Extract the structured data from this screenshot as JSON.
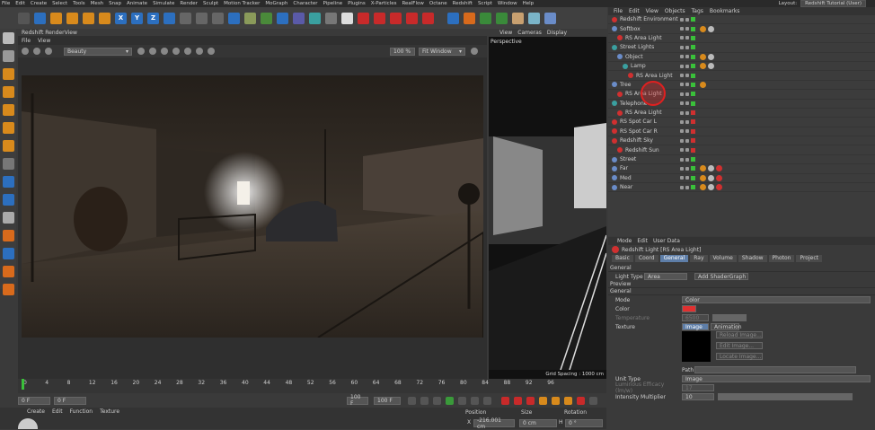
{
  "menubar": {
    "items": [
      "File",
      "Edit",
      "Create",
      "Select",
      "Tools",
      "Mesh",
      "Snap",
      "Animate",
      "Simulate",
      "Render",
      "Sculpt",
      "Motion Tracker",
      "MoGraph",
      "Character",
      "Pipeline",
      "Plugins",
      "X-Particles",
      "RealFlow",
      "Octane",
      "Redshift",
      "Script",
      "Window",
      "Help"
    ],
    "layout_label": "Layout:",
    "layout_value": "Redshift Tutorial (User)"
  },
  "toolbar": {
    "axis": [
      "X",
      "Y",
      "Z"
    ]
  },
  "renderview": {
    "title": "Redshift RenderView",
    "menu": [
      "File",
      "View"
    ],
    "aov": "Beauty",
    "zoom": "100 %",
    "fit": "Fit Window"
  },
  "viewport": {
    "menu": [
      "View",
      "Cameras",
      "Display"
    ],
    "label": "Perspective",
    "grid": "Grid Spacing : 1000 cm"
  },
  "objects": {
    "menu": [
      "File",
      "Edit",
      "View",
      "Objects",
      "Tags",
      "Bookmarks"
    ],
    "rows": [
      {
        "name": "Redshift Environment",
        "indent": 0,
        "color": "#d03030",
        "state": "green",
        "tags": 0
      },
      {
        "name": "Softbox",
        "indent": 0,
        "color": "#6a8cc8",
        "state": "green",
        "tags": 2
      },
      {
        "name": "RS Area Light",
        "indent": 1,
        "color": "#d03030",
        "state": "green",
        "tags": 0
      },
      {
        "name": "Street Lights",
        "indent": 0,
        "color": "#3aa0a0",
        "state": "green",
        "tags": 0
      },
      {
        "name": "Object",
        "indent": 1,
        "color": "#6a8cc8",
        "state": "green",
        "tags": 2
      },
      {
        "name": "Lamp",
        "indent": 2,
        "color": "#3aa0a0",
        "state": "green",
        "tags": 2
      },
      {
        "name": "RS Area Light",
        "indent": 3,
        "color": "#d03030",
        "state": "green",
        "tags": 0
      },
      {
        "name": "Tree",
        "indent": 0,
        "color": "#6a8cc8",
        "state": "green",
        "tags": 1
      },
      {
        "name": "RS Area Light",
        "indent": 1,
        "color": "#d03030",
        "state": "green",
        "tags": 0
      },
      {
        "name": "Telephone",
        "indent": 0,
        "color": "#3aa0a0",
        "state": "green",
        "tags": 0
      },
      {
        "name": "RS Area Light",
        "indent": 1,
        "color": "#d03030",
        "state": "red",
        "tags": 0
      },
      {
        "name": "RS Spot Car L",
        "indent": 0,
        "color": "#d03030",
        "state": "red",
        "tags": 0
      },
      {
        "name": "RS Spot Car R",
        "indent": 0,
        "color": "#d03030",
        "state": "red",
        "tags": 0
      },
      {
        "name": "Redshift Sky",
        "indent": 0,
        "color": "#d03030",
        "state": "red",
        "tags": 0
      },
      {
        "name": "Redshift Sun",
        "indent": 1,
        "color": "#d03030",
        "state": "red",
        "tags": 0
      },
      {
        "name": "Street",
        "indent": 0,
        "color": "#6a8cc8",
        "state": "green",
        "tags": 0
      },
      {
        "name": "Far",
        "indent": 0,
        "color": "#6a8cc8",
        "state": "green",
        "tags": 3
      },
      {
        "name": "Med",
        "indent": 0,
        "color": "#6a8cc8",
        "state": "green",
        "tags": 3
      },
      {
        "name": "Near",
        "indent": 0,
        "color": "#6a8cc8",
        "state": "green",
        "tags": 3
      }
    ]
  },
  "attributes": {
    "menu": [
      "Mode",
      "Edit",
      "User Data"
    ],
    "title": "Redshift Light [RS Area Light]",
    "tabs": [
      "Basic",
      "Coord",
      "General",
      "Ray",
      "Volume",
      "Shadow",
      "Photon",
      "Project"
    ],
    "active_tab": "General",
    "section": "General",
    "light_type_label": "Light Type",
    "light_type": "Area",
    "add_shader": "Add ShaderGraph",
    "preview": "Preview",
    "general_sub": "General",
    "mode_label": "Mode",
    "mode": "Color",
    "color_label": "Color",
    "temperature_label": "Temperature",
    "temperature": "6500",
    "texture_label": "Texture",
    "image_btn": "Image",
    "animation_btn": "Animation",
    "reload": "Reload Image...",
    "edit": "Edit Image...",
    "locate": "Locate Image...",
    "path_label": "Path",
    "unit_label": "Unit Type",
    "unit": "Image",
    "lum_label": "Luminous Efficacy (lm/w)",
    "lum": "17",
    "intensity_label": "Intensity Multiplier",
    "intensity": "10"
  },
  "timeline": {
    "ticks": [
      "0",
      "4",
      "8",
      "12",
      "16",
      "20",
      "24",
      "28",
      "32",
      "36",
      "40",
      "44",
      "48",
      "52",
      "56",
      "60",
      "64",
      "68",
      "72",
      "76",
      "80",
      "84",
      "88",
      "92",
      "96"
    ]
  },
  "transport": {
    "start": "0 F",
    "current": "0 F",
    "end": "100 F",
    "max": "100 F"
  },
  "bottom": {
    "menu": [
      "Create",
      "Edit",
      "Function",
      "Texture"
    ],
    "position_label": "Position",
    "size_label": "Size",
    "rotation_label": "Rotation",
    "x_label": "X",
    "pos_x": "-216.001 cm",
    "size_x": "0 cm",
    "h_label": "H",
    "rot_h": "0 °"
  }
}
